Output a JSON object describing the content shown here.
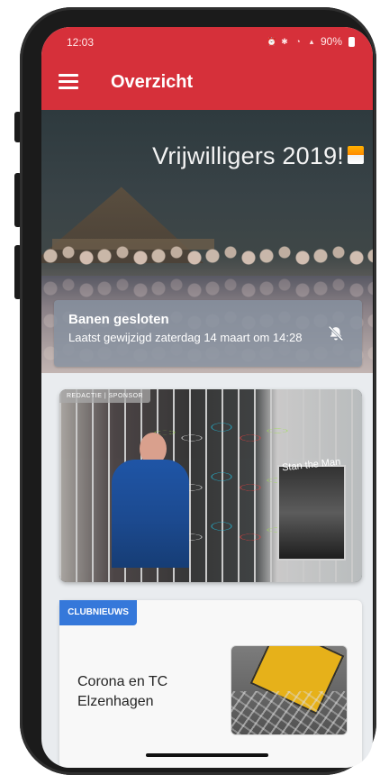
{
  "statusbar": {
    "time": "12:03",
    "battery": "90%",
    "icons": [
      "alarm-icon",
      "bluetooth-icon",
      "wifi-icon",
      "signal-icon",
      "battery-icon"
    ]
  },
  "appbar": {
    "title": "Overzicht",
    "menu_icon": "hamburger-menu-icon",
    "background_color": "#d6303a"
  },
  "hero": {
    "title": "Vrijwilligers 2019!"
  },
  "notification": {
    "title": "Banen gesloten",
    "subtitle": "Laatst gewijzigd zaterdag 14 maart om 14:28",
    "icon": "notifications-off-icon"
  },
  "feature": {
    "category": "REDACTIE | SPONSOR",
    "poster_text": "Stan the Man"
  },
  "news": {
    "category": "CLUBNIEUWS",
    "title": "Corona en TC Elzenhagen",
    "accent_color": "#3578da"
  }
}
